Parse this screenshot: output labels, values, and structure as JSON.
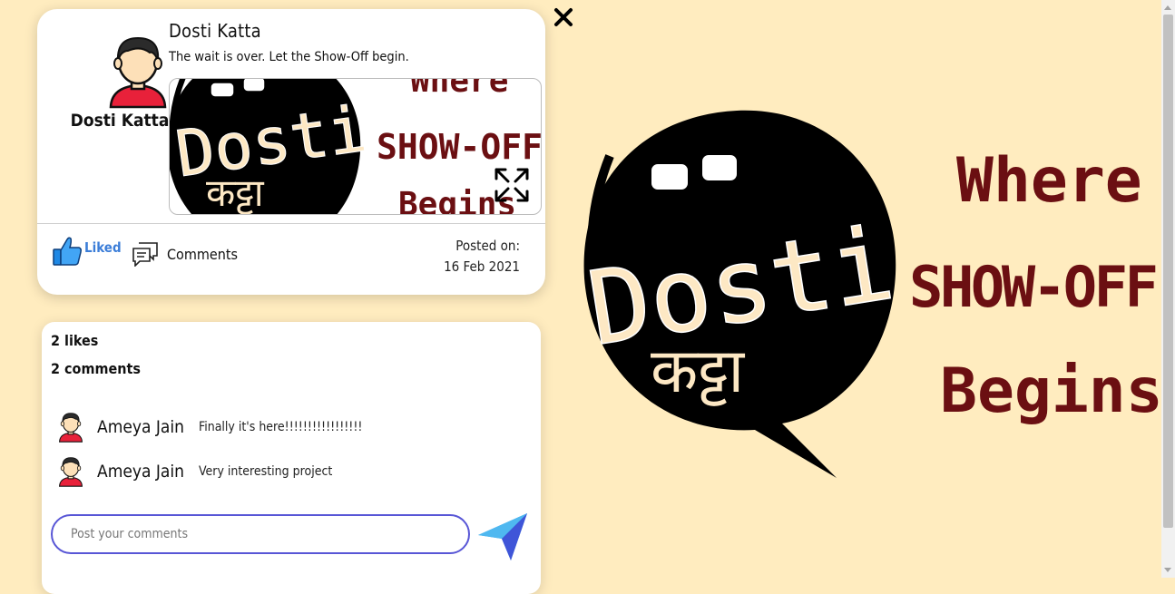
{
  "post": {
    "author": "Dosti Katta",
    "author_side_label": "Dosti Katta",
    "caption": "The wait is over. Let the Show-Off begin.",
    "liked_label": "Liked",
    "comments_label": "Comments",
    "posted_on_label": "Posted on:",
    "posted_date": "16 Feb 2021"
  },
  "logo": {
    "brand_text": "Dosti",
    "brand_script": "कट्टा",
    "tagline": [
      "Where",
      "SHOW-OFF",
      "Begins"
    ],
    "tagline_color": "#6b0f12"
  },
  "stats": {
    "likes": "2 likes",
    "comments": "2 comments"
  },
  "comments": [
    {
      "user": "Ameya Jain",
      "text": "Finally it's here!!!!!!!!!!!!!!!!!"
    },
    {
      "user": "Ameya Jain",
      "text": "Very interesting project"
    }
  ],
  "input": {
    "placeholder": "Post your comments"
  },
  "colors": {
    "background": "#ffecbf",
    "accent": "#3b7dd8",
    "input_border": "#5856d6"
  }
}
